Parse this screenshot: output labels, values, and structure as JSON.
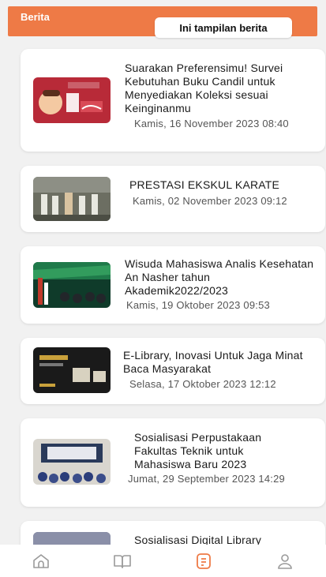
{
  "header": {
    "title": "Berita",
    "tooltip": "Ini tampilan berita"
  },
  "news": [
    {
      "title": "Suarakan Preferensimu! Survei Kebutuhan Buku Candil untuk Menyediakan Koleksi sesuai Keinginanmu",
      "date": "Kamis, 16 November 2023 08:40"
    },
    {
      "title": "PRESTASI EKSKUL KARATE",
      "date": "Kamis, 02 November 2023 09:12"
    },
    {
      "title": "Wisuda Mahasiswa Analis Kesehatan An Nasher tahun Akademik2022/2023",
      "date": "Kamis, 19 Oktober 2023 09:53"
    },
    {
      "title": "E-Library, Inovasi Untuk Jaga Minat Baca Masyarakat",
      "date": "Selasa, 17 Oktober 2023 12:12"
    },
    {
      "title": "Sosialisasi Perpustakaan Fakultas Teknik untuk Mahasiswa Baru 2023",
      "date": "Jumat, 29 September 2023 14:29"
    },
    {
      "title": "Sosialisasi Digital Library"
    }
  ],
  "nav": [
    {
      "icon": "home-icon"
    },
    {
      "icon": "book-icon"
    },
    {
      "icon": "news-icon",
      "active": true
    },
    {
      "icon": "profile-icon"
    }
  ],
  "colors": {
    "accent": "#ee7a46",
    "inactive": "#9a9a9a"
  }
}
